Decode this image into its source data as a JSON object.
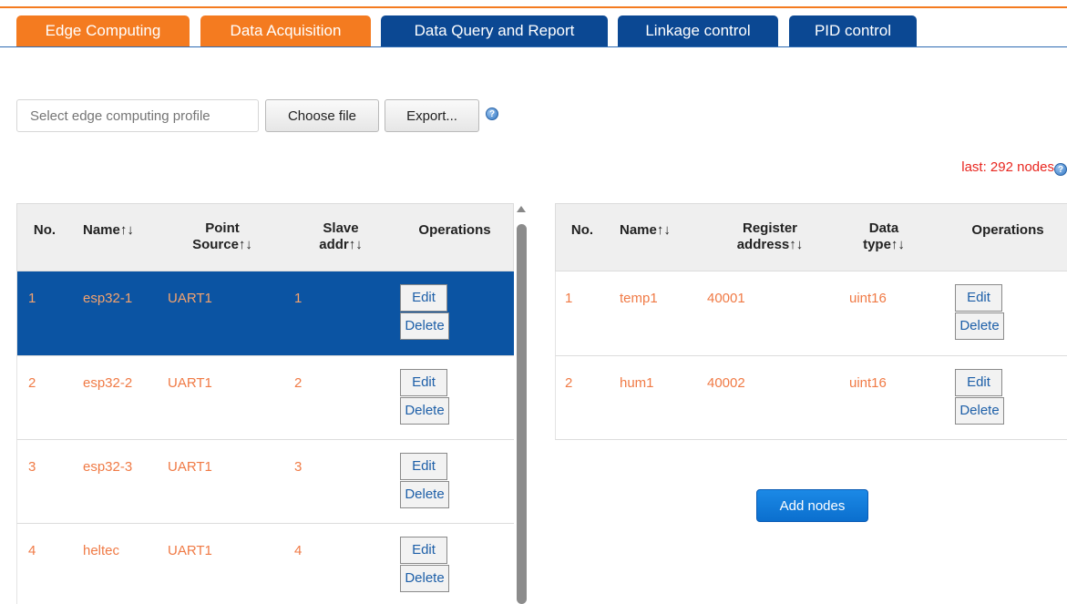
{
  "tabs": [
    {
      "label": "Edge Computing"
    },
    {
      "label": "Data Acquisition"
    },
    {
      "label": "Data Query and Report"
    },
    {
      "label": "Linkage control"
    },
    {
      "label": "PID control"
    }
  ],
  "toolbar": {
    "profile_placeholder": "Select edge computing profile",
    "choose_file_label": "Choose file",
    "export_label": "Export..."
  },
  "help_glyph": "?",
  "last_info": "last: 292 nodes",
  "sort_glyph": "↑↓",
  "devices_table": {
    "headers": {
      "no": "No.",
      "name": "Name↑↓",
      "point_source_line1": "Point",
      "point_source_line2": "Source↑↓",
      "slave_addr_line1": "Slave",
      "slave_addr_line2": "addr↑↓",
      "operations": "Operations"
    },
    "rows": [
      {
        "no": "1",
        "name": "esp32-1",
        "source": "UART1",
        "addr": "1",
        "selected": true
      },
      {
        "no": "2",
        "name": "esp32-2",
        "source": "UART1",
        "addr": "2",
        "selected": false
      },
      {
        "no": "3",
        "name": "esp32-3",
        "source": "UART1",
        "addr": "3",
        "selected": false
      },
      {
        "no": "4",
        "name": "heltec",
        "source": "UART1",
        "addr": "4",
        "selected": false
      }
    ]
  },
  "nodes_table": {
    "headers": {
      "no": "No.",
      "name": "Name↑↓",
      "register_line1": "Register",
      "register_line2": "address↑↓",
      "datatype_line1": "Data",
      "datatype_line2": "type↑↓",
      "operations": "Operations"
    },
    "rows": [
      {
        "no": "1",
        "name": "temp1",
        "register": "40001",
        "datatype": "uint16"
      },
      {
        "no": "2",
        "name": "hum1",
        "register": "40002",
        "datatype": "uint16"
      }
    ]
  },
  "row_buttons": {
    "edit": "Edit",
    "delete": "Delete"
  },
  "add_nodes_label": "Add nodes",
  "colors": {
    "tab_orange": "#f47b20",
    "tab_blue": "#0b4893",
    "selected_row": "#0b54a3",
    "cell_text": "#f07a45",
    "last_info": "#e8261f",
    "add_button": "#0b6fce"
  }
}
